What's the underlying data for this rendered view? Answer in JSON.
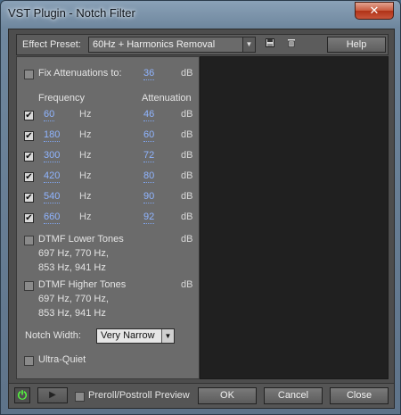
{
  "window": {
    "title": "VST Plugin - Notch Filter",
    "close_glyph": "✕"
  },
  "topbar": {
    "preset_label": "Effect Preset:",
    "preset_value": "60Hz + Harmonics Removal",
    "save_icon": "floppy-icon",
    "delete_icon": "trash-icon",
    "help_label": "Help"
  },
  "fix": {
    "label": "Fix Attenuations to:",
    "value": "36",
    "unit": "dB",
    "checked": false
  },
  "headers": {
    "frequency": "Frequency",
    "attenuation": "Attenuation"
  },
  "notches": [
    {
      "checked": true,
      "freq": "60",
      "freq_unit": "Hz",
      "atten": "46",
      "atten_unit": "dB"
    },
    {
      "checked": true,
      "freq": "180",
      "freq_unit": "Hz",
      "atten": "60",
      "atten_unit": "dB"
    },
    {
      "checked": true,
      "freq": "300",
      "freq_unit": "Hz",
      "atten": "72",
      "atten_unit": "dB"
    },
    {
      "checked": true,
      "freq": "420",
      "freq_unit": "Hz",
      "atten": "80",
      "atten_unit": "dB"
    },
    {
      "checked": true,
      "freq": "540",
      "freq_unit": "Hz",
      "atten": "90",
      "atten_unit": "dB"
    },
    {
      "checked": true,
      "freq": "660",
      "freq_unit": "Hz",
      "atten": "92",
      "atten_unit": "dB"
    }
  ],
  "dtmf_lower": {
    "label": "DTMF Lower Tones",
    "line2": "697 Hz, 770 Hz,",
    "line3": "853 Hz, 941 Hz",
    "unit": "dB",
    "checked": false
  },
  "dtmf_higher": {
    "label": "DTMF Higher Tones",
    "line2": "697 Hz, 770 Hz,",
    "line3": "853 Hz, 941 Hz",
    "unit": "dB",
    "checked": false
  },
  "notch_width": {
    "label": "Notch Width:",
    "value": "Very Narrow"
  },
  "ultra_quiet": {
    "label": "Ultra-Quiet",
    "checked": false
  },
  "bottombar": {
    "preroll_label": "Preroll/Postroll Preview",
    "ok_label": "OK",
    "cancel_label": "Cancel",
    "close_label": "Close"
  },
  "colors": {
    "value_link": "#8fb4ff",
    "power_on": "#54ff3d"
  }
}
